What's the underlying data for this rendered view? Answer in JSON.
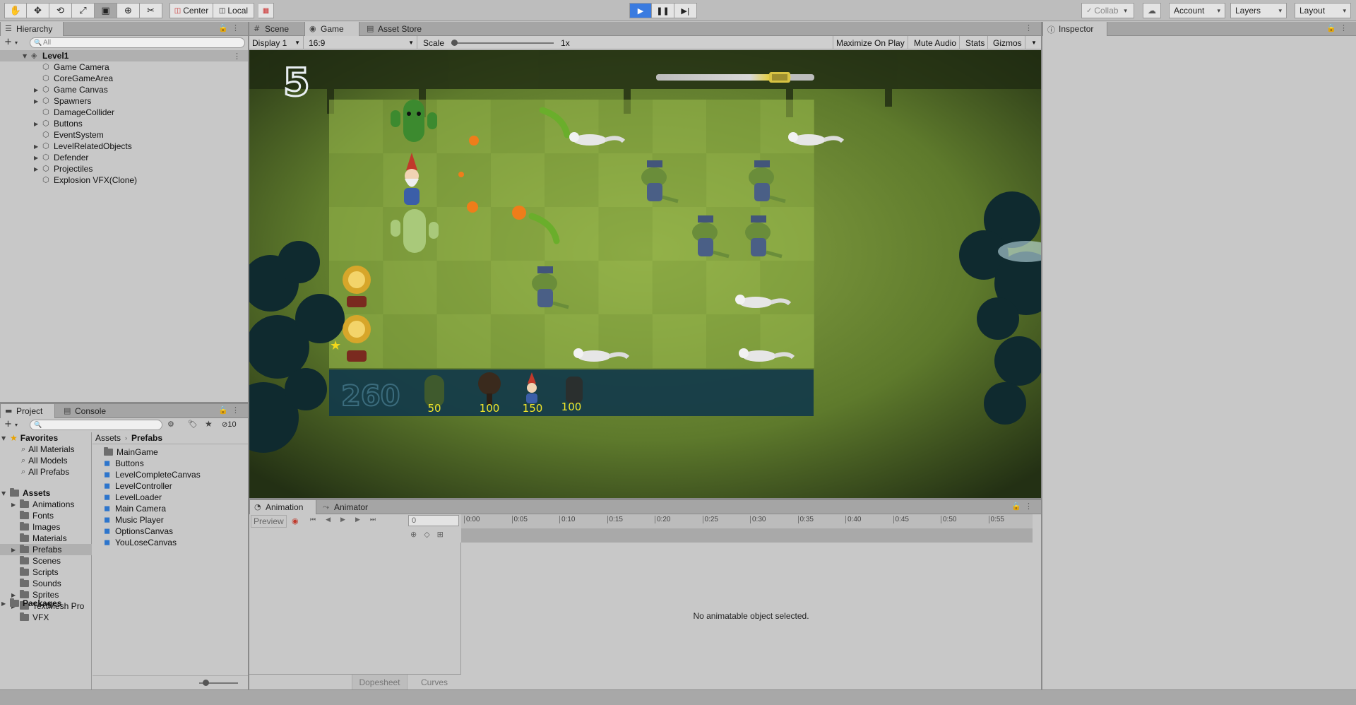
{
  "toolbar": {
    "tools": [
      "hand-tool-icon",
      "move-tool-icon",
      "rotate-tool-icon",
      "scale-tool-icon",
      "rect-tool-icon",
      "transform-tool-icon",
      "custom-tool-icon"
    ],
    "pivot_label": "Center",
    "space_label": "Local",
    "collab_label": "Collab",
    "account_label": "Account",
    "layers_label": "Layers",
    "layout_label": "Layout"
  },
  "hierarchy": {
    "tab_label": "Hierarchy",
    "add_label": "+",
    "search_placeholder": "All",
    "scene_name": "Level1",
    "items": [
      {
        "label": "Game Camera",
        "expandable": false
      },
      {
        "label": "CoreGameArea",
        "expandable": false
      },
      {
        "label": "Game Canvas",
        "expandable": true
      },
      {
        "label": "Spawners",
        "expandable": true
      },
      {
        "label": "DamageCollider",
        "expandable": false
      },
      {
        "label": "Buttons",
        "expandable": true
      },
      {
        "label": "EventSystem",
        "expandable": false
      },
      {
        "label": "LevelRelatedObjects",
        "expandable": true
      },
      {
        "label": "Defender",
        "expandable": true
      },
      {
        "label": "Projectiles",
        "expandable": true
      },
      {
        "label": "Explosion VFX(Clone)",
        "expandable": false
      }
    ]
  },
  "project": {
    "tab_label": "Project",
    "console_tab_label": "Console",
    "hidden_count": "10",
    "favorites_label": "Favorites",
    "favorites": [
      "All Materials",
      "All Models",
      "All Prefabs"
    ],
    "assets_label": "Assets",
    "asset_folders": [
      {
        "label": "Animations",
        "expandable": true
      },
      {
        "label": "Fonts",
        "expandable": false
      },
      {
        "label": "Images",
        "expandable": false
      },
      {
        "label": "Materials",
        "expandable": false
      },
      {
        "label": "Prefabs",
        "expandable": true
      },
      {
        "label": "Scenes",
        "expandable": false
      },
      {
        "label": "Scripts",
        "expandable": false
      },
      {
        "label": "Sounds",
        "expandable": false
      },
      {
        "label": "Sprites",
        "expandable": true
      },
      {
        "label": "TextMesh Pro",
        "expandable": true
      },
      {
        "label": "VFX",
        "expandable": false
      }
    ],
    "packages_label": "Packages",
    "breadcrumb_root": "Assets",
    "breadcrumb_current": "Prefabs",
    "prefabs": [
      {
        "label": "MainGame",
        "type": "folder"
      },
      {
        "label": "Buttons",
        "type": "prefab"
      },
      {
        "label": "LevelCompleteCanvas",
        "type": "prefab"
      },
      {
        "label": "LevelController",
        "type": "prefab"
      },
      {
        "label": "LevelLoader",
        "type": "prefab"
      },
      {
        "label": "Main Camera",
        "type": "prefab"
      },
      {
        "label": "Music Player",
        "type": "prefab"
      },
      {
        "label": "OptionsCanvas",
        "type": "prefab"
      },
      {
        "label": "YouLoseCanvas",
        "type": "prefab"
      }
    ]
  },
  "game_view": {
    "tabs": [
      "Scene",
      "Game",
      "Asset Store"
    ],
    "display_label": "Display 1",
    "aspect_label": "16:9",
    "scale_label": "Scale",
    "scale_value": "1x",
    "maximize_label": "Maximize On Play",
    "mute_label": "Mute Audio",
    "stats_label": "Stats",
    "gizmos_label": "Gizmos",
    "timer_value": "5",
    "level_progress": 0.85,
    "stars_value": "260",
    "defender_costs": [
      "50",
      "100",
      "150",
      "100"
    ]
  },
  "animation": {
    "tab_label": "Animation",
    "animator_tab_label": "Animator",
    "preview_label": "Preview",
    "frame_value": "0",
    "ticks": [
      "0:00",
      "0:05",
      "0:10",
      "0:15",
      "0:20",
      "0:25",
      "0:30",
      "0:35",
      "0:40",
      "0:45",
      "0:50",
      "0:55"
    ],
    "message": "No animatable object selected.",
    "dopesheet_label": "Dopesheet",
    "curves_label": "Curves"
  },
  "inspector": {
    "tab_label": "Inspector"
  }
}
